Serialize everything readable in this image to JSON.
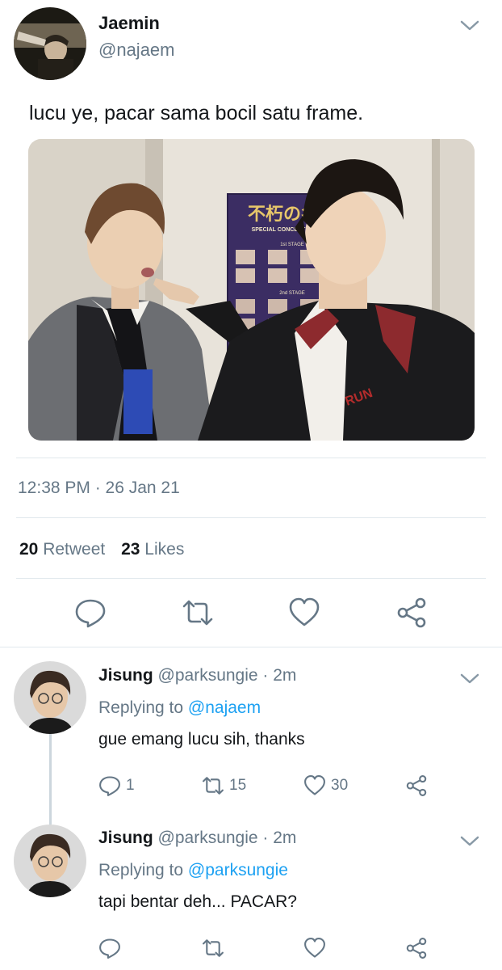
{
  "main_tweet": {
    "author_name": "Jaemin",
    "author_handle": "@najaem",
    "text": "lucu ye, pacar sama bocil satu frame.",
    "photo_poster": {
      "title_jp": "不朽の名曲",
      "subtitle": "SPECIAL CONCERT IN JAPAN",
      "stage_1": "1st STAGE",
      "stage_2": "2nd STAGE",
      "shirt_text": "RUN"
    },
    "timestamp": "12:38 PM · 26 Jan 21",
    "retweets": "20",
    "retweet_label": "Retweet",
    "likes": "23",
    "likes_label": "Likes",
    "actions": [
      "reply-icon",
      "retweet-icon",
      "like-icon",
      "share-icon"
    ]
  },
  "replies": [
    {
      "name": "Jisung",
      "handle_time": "@parksungie · 2m",
      "replying_prefix": "Replying to ",
      "replying_to": "@najaem",
      "text": "gue emang lucu sih, thanks",
      "reply_count": "1",
      "retweet_count": "15",
      "like_count": "30"
    },
    {
      "name": "Jisung",
      "handle_time": "@parksungie · 2m",
      "replying_prefix": "Replying to ",
      "replying_to": "@parksungie",
      "text": "tapi bentar deh... PACAR?",
      "reply_count": "",
      "retweet_count": "",
      "like_count": ""
    }
  ],
  "colors": {
    "text": "#14171a",
    "secondary": "#657786",
    "link": "#1da1f2",
    "divider": "#e1e8ed",
    "icon": "#657786"
  }
}
